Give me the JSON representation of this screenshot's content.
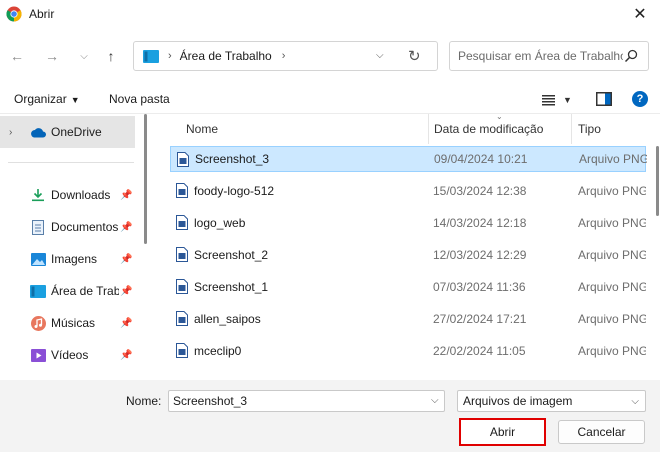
{
  "window": {
    "title": "Abrir"
  },
  "address": {
    "breadcrumb": "Área de Trabalho"
  },
  "search": {
    "placeholder": "Pesquisar em Área de Trabalho"
  },
  "commands": {
    "organize": "Organizar",
    "new_folder": "Nova pasta"
  },
  "sidebar": {
    "items": [
      {
        "label": "OneDrive",
        "icon": "cloud-icon"
      },
      {
        "label": "Downloads",
        "icon": "download-icon"
      },
      {
        "label": "Documentos",
        "icon": "document-icon"
      },
      {
        "label": "Imagens",
        "icon": "image-icon"
      },
      {
        "label": "Área de Trabalho",
        "icon": "desktop-icon"
      },
      {
        "label": "Músicas",
        "icon": "music-icon"
      },
      {
        "label": "Vídeos",
        "icon": "video-icon"
      }
    ]
  },
  "columns": {
    "name": "Nome",
    "date": "Data de modificação",
    "type": "Tipo"
  },
  "files": [
    {
      "name": "Screenshot_3",
      "date": "09/04/2024 10:21",
      "type": "Arquivo PNG"
    },
    {
      "name": "foody-logo-512",
      "date": "15/03/2024 12:38",
      "type": "Arquivo PNG"
    },
    {
      "name": "logo_web",
      "date": "14/03/2024 12:18",
      "type": "Arquivo PNG"
    },
    {
      "name": "Screenshot_2",
      "date": "12/03/2024 12:29",
      "type": "Arquivo PNG"
    },
    {
      "name": "Screenshot_1",
      "date": "07/03/2024 11:36",
      "type": "Arquivo PNG"
    },
    {
      "name": "allen_saipos",
      "date": "27/02/2024 17:21",
      "type": "Arquivo PNG"
    },
    {
      "name": "mceclip0",
      "date": "22/02/2024 11:05",
      "type": "Arquivo PNG"
    }
  ],
  "bottom": {
    "name_label": "Nome:",
    "name_value": "Screenshot_3",
    "file_type": "Arquivos de imagem",
    "open_label": "Abrir",
    "cancel_label": "Cancelar"
  },
  "colors": {
    "accent": "#0067c0",
    "selection": "#cce8ff",
    "highlight_border": "#e00000"
  }
}
